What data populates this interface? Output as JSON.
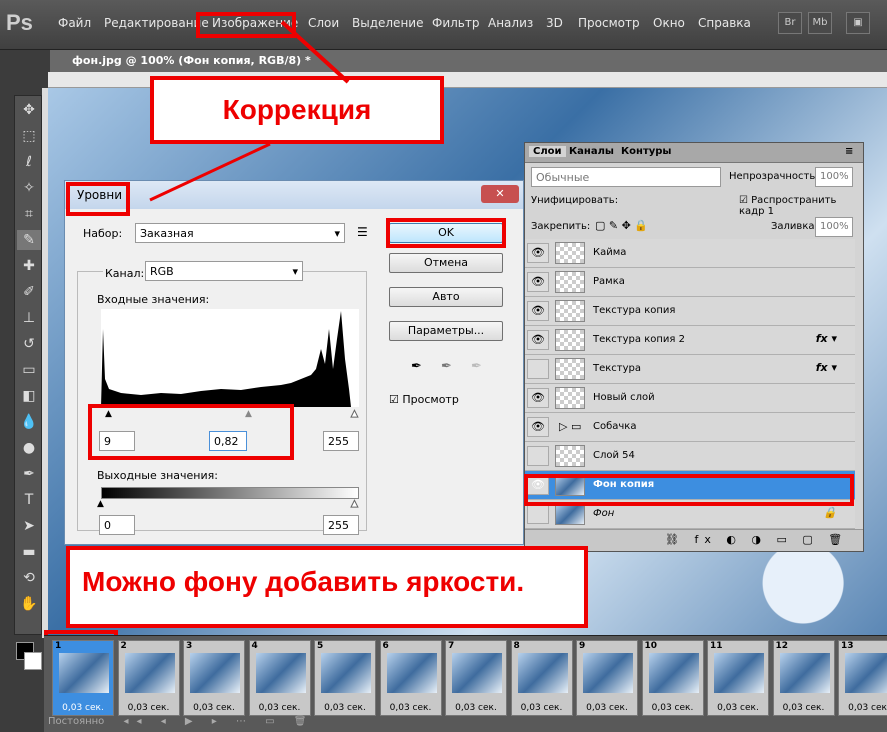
{
  "app": {
    "logo": "Ps",
    "menu": [
      "Файл",
      "Редактирование",
      "Изображение",
      "Слои",
      "Выделение",
      "Фильтр",
      "Анализ",
      "3D",
      "Просмотр",
      "Окно",
      "Справка"
    ],
    "right_icons": [
      "Br",
      "Mb"
    ]
  },
  "document": {
    "title": "фон.jpg @ 100% (Фон копия, RGB/8) *"
  },
  "layers_panel": {
    "tabs": [
      "Слои",
      "Каналы",
      "Контуры"
    ],
    "blend_mode": "Обычные",
    "opacity_label": "Непрозрачность:",
    "opacity_value": "100%",
    "unify_label": "Унифицировать:",
    "propagate_label": "Распространить кадр 1",
    "lock_label": "Закрепить:",
    "fill_label": "Заливка:",
    "fill_value": "100%",
    "layers": [
      {
        "name": "Кайма",
        "visible": true,
        "fx": false
      },
      {
        "name": "Рамка",
        "visible": true,
        "fx": false
      },
      {
        "name": "Текстура копия",
        "visible": true,
        "fx": false
      },
      {
        "name": "Текстура копия 2",
        "visible": true,
        "fx": true
      },
      {
        "name": "Текстура",
        "visible": false,
        "fx": true
      },
      {
        "name": "Новый слой",
        "visible": true,
        "fx": false
      },
      {
        "name": "Собачка",
        "visible": true,
        "fx": false,
        "group": true
      },
      {
        "name": "Слой 54",
        "visible": false,
        "fx": false
      },
      {
        "name": "Фон копия",
        "visible": true,
        "fx": false,
        "selected": true
      },
      {
        "name": "Фон",
        "visible": false,
        "fx": false,
        "locked": true
      }
    ]
  },
  "levels": {
    "title": "Уровни",
    "preset_label": "Набор:",
    "preset_value": "Заказная",
    "channel_label": "Канал:",
    "channel_value": "RGB",
    "input_label": "Входные значения:",
    "input_black": "9",
    "input_gamma": "0,82",
    "input_white": "255",
    "output_label": "Выходные значения:",
    "output_black": "0",
    "output_white": "255",
    "ok": "OK",
    "cancel": "Отмена",
    "auto": "Авто",
    "options": "Параметры...",
    "preview": "Просмотр"
  },
  "callouts": {
    "correction": "Коррекция",
    "brightness": "Можно фону добавить яркости."
  },
  "timeline": {
    "frames": [
      "1",
      "2",
      "3",
      "4",
      "5",
      "6",
      "7",
      "8",
      "9",
      "10",
      "11",
      "12",
      "13"
    ],
    "delay": "0,03 сек.",
    "loop": "Постоянно"
  }
}
